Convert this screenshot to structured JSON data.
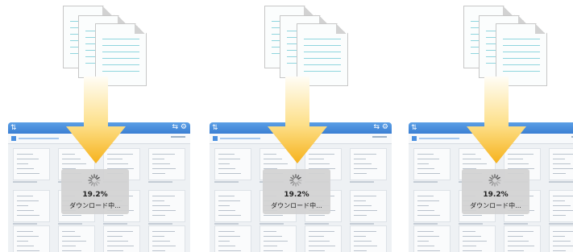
{
  "panels": [
    {
      "progress_text": "19.2%",
      "status_text": "ダウンロード中..."
    },
    {
      "progress_text": "19.2%",
      "status_text": "ダウンロード中..."
    },
    {
      "progress_text": "19.2%",
      "status_text": "ダウンロード中..."
    }
  ],
  "colors": {
    "arrow_top": "#fff9e8",
    "arrow_bottom": "#f6b21c",
    "toolbar": "#3b7fd3",
    "doc_line": "#8fd5de",
    "hud": "#d2d2d2"
  },
  "icons": [
    "documents-stack-icon",
    "download-arrow-icon",
    "loading-spinner-icon"
  ]
}
